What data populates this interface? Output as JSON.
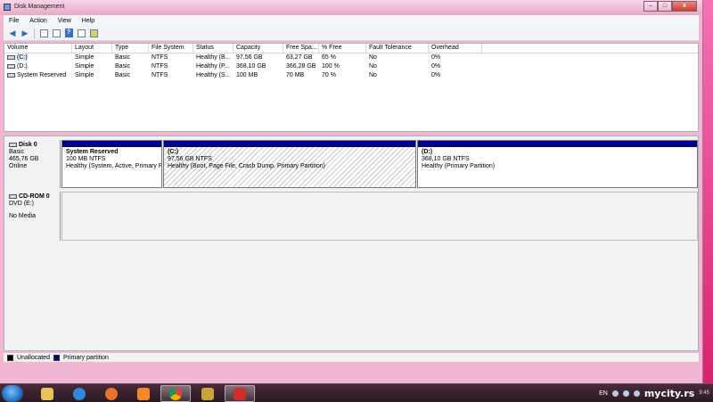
{
  "window": {
    "title": "Disk Management"
  },
  "menu": [
    "File",
    "Action",
    "View",
    "Help"
  ],
  "columns": [
    "Volume",
    "Layout",
    "Type",
    "File System",
    "Status",
    "Capacity",
    "Free Spa...",
    "% Free",
    "Fault Tolerance",
    "Overhead"
  ],
  "volumes": [
    [
      "(C:)",
      "Simple",
      "Basic",
      "NTFS",
      "Healthy (B...",
      "97,56 GB",
      "63,27 GB",
      "65 %",
      "No",
      "0%"
    ],
    [
      "(D:)",
      "Simple",
      "Basic",
      "NTFS",
      "Healthy (P...",
      "368,10 GB",
      "366,28 GB",
      "100 %",
      "No",
      "0%"
    ],
    [
      "System Reserved",
      "Simple",
      "Basic",
      "NTFS",
      "Healthy (S...",
      "100 MB",
      "70 MB",
      "70 %",
      "No",
      "0%"
    ]
  ],
  "disk0": {
    "name": "Disk 0",
    "type": "Basic",
    "size": "465,76 GB",
    "status": "Online",
    "partitions": [
      {
        "name": "System Reserved",
        "size": "100 MB NTFS",
        "status": "Healthy (System, Active, Primary P"
      },
      {
        "name": "(C:)",
        "size": "97,56 GB NTFS",
        "status": "Healthy (Boot, Page File, Crash Dump, Primary Partition)"
      },
      {
        "name": "(D:)",
        "size": "368,10 GB NTFS",
        "status": "Healthy (Primary Partition)"
      }
    ]
  },
  "cdrom": {
    "name": "CD-ROM 0",
    "type": "DVD (E:)",
    "status": "No Media"
  },
  "legend": {
    "unallocated": "Unallocated",
    "primary": "Primary partition"
  },
  "colors": {
    "primary": "#00008b",
    "unallocated": "#000000"
  },
  "taskbar": {
    "apps": [
      "windows-explorer",
      "internet-explorer",
      "firefox",
      "media-player",
      "chrome",
      "app",
      "disk-management"
    ],
    "language": "EN",
    "brand": "mycity.rs",
    "clock": "9:45"
  }
}
